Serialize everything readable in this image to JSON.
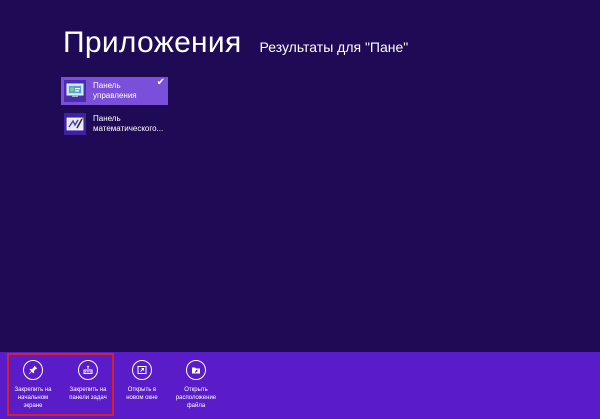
{
  "header": {
    "title": "Приложения",
    "subtitle": "Результаты для \"Пане\""
  },
  "results": [
    {
      "label_line1": "Панель",
      "label_line2": "управления",
      "icon": "control-panel-icon",
      "selected": true
    },
    {
      "label_line1": "Панель",
      "label_line2": "математического...",
      "icon": "math-input-panel-icon",
      "selected": false
    }
  ],
  "appbar": {
    "commands": [
      {
        "label": "Закрепить на\nначальном\nэкране",
        "icon": "pin-icon"
      },
      {
        "label": "Закрепить на\nпанели задач",
        "icon": "pin-taskbar-icon"
      },
      {
        "label": "Открыть в\nновом окне",
        "icon": "new-window-icon"
      },
      {
        "label": "Открыть\nрасположение\nфайла",
        "icon": "folder-location-icon"
      }
    ]
  },
  "colors": {
    "background": "#1f0a55",
    "appbar": "#5a1cc9",
    "selection": "#7a4fd9",
    "highlight": "#d8202a"
  }
}
